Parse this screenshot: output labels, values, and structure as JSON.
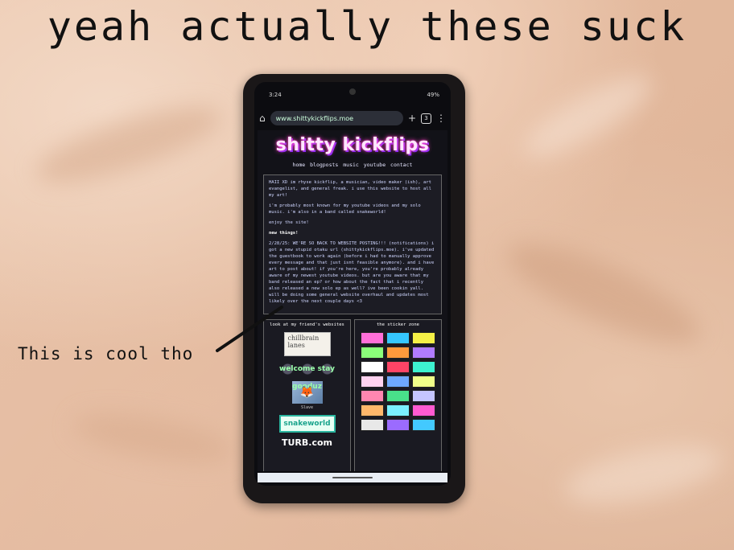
{
  "headline": "yeah actually these suck",
  "caption": "This is cool tho",
  "phone": {
    "status": {
      "time": "3:24",
      "battery": "49%"
    },
    "browser": {
      "url": "www.shittykickflips.moe",
      "tab_count": "3"
    },
    "site": {
      "title": "shitty kickflips",
      "nav": "home blogposts music youtube contact",
      "intro": [
        "HAII XD im rhyse kickflip, a musician, video maker (ish), art evangelist, and general freak. i use this website to host all my art!",
        "i'm probably most known for my youtube videos and my solo music. i'm also in a band called snakeworld!",
        "enjoy the site!"
      ],
      "news_heading": "new things!",
      "news": "2/28/25: WE'RE SO BACK TO WEBSITE POSTING!!! (notifications) i got a new stupid otaku url (shittykickflips.moe). i've updated the guestbook to work again (before i had to manually approve every message and that just isnt feasible anymore). and i have art to post about! if you're here, you're probably already aware of my newest youtube videos. but are you aware that my band released an ep? or how about the fact that i recently also released a new solo ep as well? ive been cookin yall. will be doing some general website overhaul and updates most likely over the next couple days <3",
      "left_column_title": "look at my friend's websites",
      "right_column_title": "the sticker zone",
      "friend_buttons": {
        "chillbrain": "chillbrain lanes",
        "swirl": "welcome stay gooduz",
        "fox_caption": "Slave",
        "snakeworld": "snakeworld",
        "turb": "TURB.com"
      },
      "sticker_colors": [
        "#ff6fd8",
        "#35c7ff",
        "#f5f046",
        "#8bff7a",
        "#ff9a3c",
        "#b07bff",
        "#ffffff",
        "#ff4466",
        "#3df2d0",
        "#ffd2f0",
        "#6ea8ff",
        "#f1ff8a",
        "#ff86b0",
        "#49e08a",
        "#c5c5ff",
        "#ffb86b",
        "#7af0ff",
        "#ff5ad1",
        "#e8e8e8",
        "#9b6bff",
        "#43c9ff"
      ]
    }
  }
}
